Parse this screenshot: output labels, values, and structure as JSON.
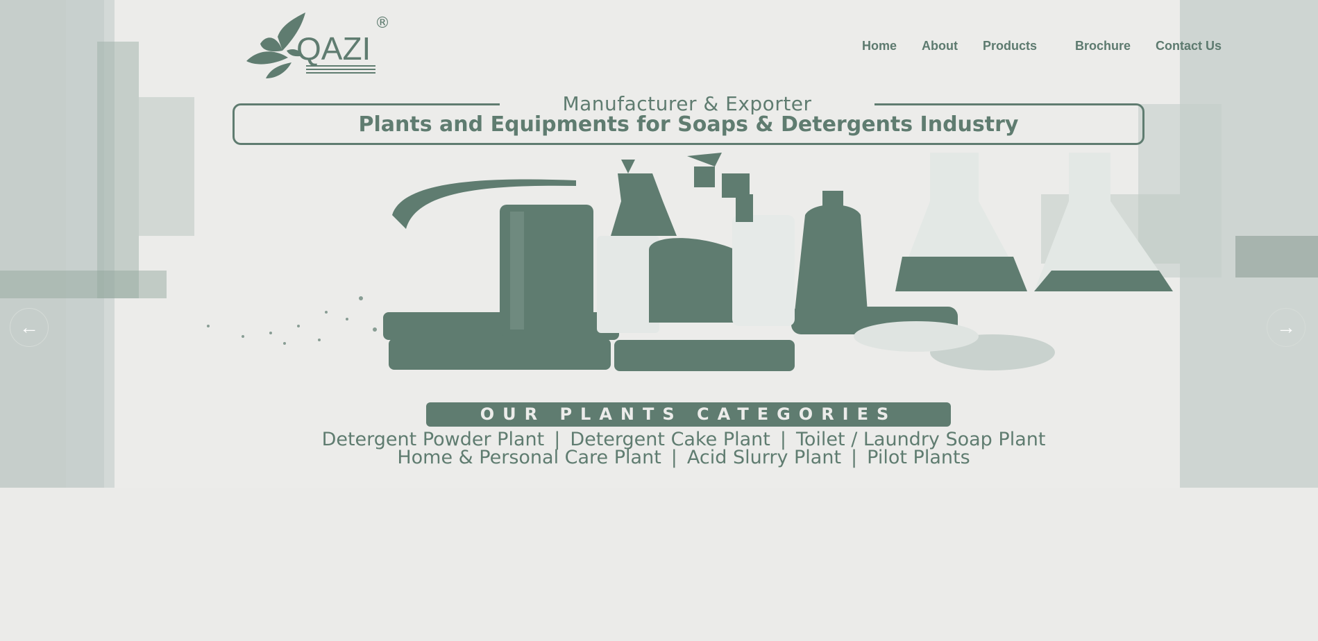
{
  "brand": {
    "name": "QAZI",
    "registered": "®"
  },
  "nav": {
    "home": "Home",
    "about": "About",
    "products": "Products",
    "brochure": "Brochure",
    "contact": "Contact Us"
  },
  "hero": {
    "tagline_sub": "Manufacturer & Exporter",
    "tagline_main": "Plants and Equipments for Soaps & Detergents Industry",
    "categories_title": "OUR PLANTS CATEGORIES",
    "categories_line1": [
      "Detergent Powder Plant",
      "Detergent Cake Plant",
      "Toilet / Laundry Soap Plant"
    ],
    "categories_line2": [
      "Home & Personal Care Plant",
      "Acid Slurry Plant",
      "Pilot Plants"
    ],
    "separator": "|",
    "prev_arrow": "←",
    "next_arrow": "→"
  },
  "colors": {
    "accent": "#5f7c70",
    "background": "#ebebe9"
  },
  "icons": [
    "leaf-logo-icon",
    "arrow-left-icon",
    "arrow-right-icon"
  ]
}
